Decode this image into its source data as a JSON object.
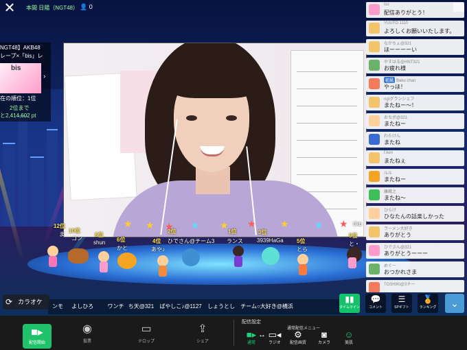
{
  "top_bar": {
    "close_icon": "close-icon",
    "room_title": "本間 日陽（NGT48）",
    "viewer_count": "0"
  },
  "ranking_panel": {
    "event_title_1": "NGT48】AKB48",
    "event_title_2": "レープ×「bis」レ",
    "thumb_text": "bis",
    "current_rank": "在の順位：1位",
    "next_rank_label": "2位まで",
    "points_to_next": "と2,414,602 pt"
  },
  "audience": {
    "ranks": [
      "12位",
      "10位",
      "8位",
      "6位",
      "4位",
      "2位",
      "1位",
      "3位",
      "5位",
      "9位"
    ],
    "names": [
      "ま",
      "コン",
      "shun",
      "かと",
      "あや♪",
      "ひでさん@チーム3",
      "ランス",
      "3939HaGa",
      "とら",
      "と・"
    ],
    "bottom_names": [
      "ンモ",
      "よしひろ",
      "ワンチ",
      "ち天@321",
      "ぱやしこ♪@1127",
      "しょうとし",
      "チーム○大好き@横浜"
    ],
    "points_fragment": "0kb"
  },
  "comments": [
    {
      "user": "iso",
      "text": "配信ありがとう！",
      "badge": ""
    },
    {
      "user": "YUUTO 1110",
      "text": "よろしくお願いいたします。",
      "badge": ""
    },
    {
      "user": "なかちょ@321",
      "text": "ほーーーーい",
      "badge": ""
    },
    {
      "user": "やすはる@HNT321",
      "text": "お疲れ様",
      "badge": ""
    },
    {
      "user": "Baku chan",
      "text": "やっほ！",
      "badge": "初見"
    },
    {
      "user": "ngtグランシェフ",
      "text": "またねー〜！",
      "badge": ""
    },
    {
      "user": "おちポ@321",
      "text": "またねー",
      "badge": ""
    },
    {
      "user": "わたけん",
      "text": "またね",
      "badge": ""
    },
    {
      "user": "f.ken",
      "text": "またねぇ",
      "badge": ""
    },
    {
      "user": "ルル",
      "text": "またねー",
      "badge": ""
    },
    {
      "user": "康蔵之",
      "text": "またね〜",
      "badge": ""
    },
    {
      "user": "ひらけ",
      "text": "ひなたんの話楽しかった",
      "badge": ""
    },
    {
      "user": "ラーメン大好き",
      "text": "ありがとう",
      "badge": ""
    },
    {
      "user": "ひでさん@321",
      "text": "ありがとうーーー",
      "badge": ""
    },
    {
      "user": "めぐー",
      "text": "おつかれさま",
      "badge": ""
    },
    {
      "user": "TOSHIKI@3チー",
      "text": "",
      "badge": ""
    }
  ],
  "karaoke": {
    "icon": "refresh-icon",
    "label": "カラオケ"
  },
  "action_buttons": {
    "timeline": "タイムライン",
    "comment": "コメント",
    "sp_gift": "SPギフト",
    "ranking": "ランキング"
  },
  "bottom_bar": {
    "start_label": "配信開始",
    "vote_label": "投票",
    "telop_label": "テロップ",
    "share_label": "シェア",
    "settings_title": "配信設定",
    "menu_title": "通常配信メニュー",
    "mode_normal": "通常",
    "mode_radio": "ラジオ",
    "quality": "配信画質",
    "camera": "カメラ",
    "beauty": "美肌"
  },
  "colors": {
    "accent_green": "#1fc26a",
    "rank_gold": "#ffe14a",
    "chevron_blue": "#4b9bd6"
  }
}
